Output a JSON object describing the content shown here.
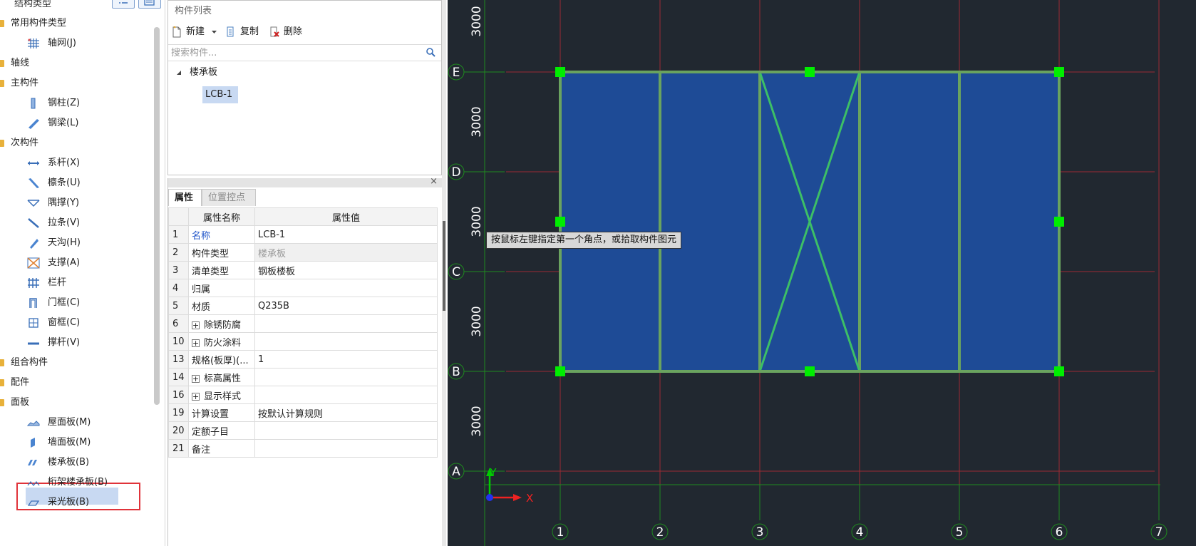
{
  "tree": {
    "header_title": "结构类型",
    "items": [
      {
        "label": "常用构件类型",
        "kind": "group",
        "icon": "folder-icon"
      },
      {
        "label": "轴网(J)",
        "kind": "leaf",
        "icon": "grid-icon"
      },
      {
        "label": "轴线",
        "kind": "group",
        "icon": "folder-icon"
      },
      {
        "label": "主构件",
        "kind": "group",
        "icon": "folder-icon"
      },
      {
        "label": "钢柱(Z)",
        "kind": "leaf",
        "icon": "steel-column-icon"
      },
      {
        "label": "钢梁(L)",
        "kind": "leaf",
        "icon": "steel-beam-icon"
      },
      {
        "label": "次构件",
        "kind": "group",
        "icon": "folder-icon"
      },
      {
        "label": "系杆(X)",
        "kind": "leaf",
        "icon": "tie-rod-icon"
      },
      {
        "label": "檩条(U)",
        "kind": "leaf",
        "icon": "purlin-icon"
      },
      {
        "label": "隅撑(Y)",
        "kind": "leaf",
        "icon": "corner-brace-icon"
      },
      {
        "label": "拉条(V)",
        "kind": "leaf",
        "icon": "sag-rod-icon"
      },
      {
        "label": "天沟(H)",
        "kind": "leaf",
        "icon": "gutter-icon"
      },
      {
        "label": "支撑(A)",
        "kind": "leaf",
        "icon": "brace-icon"
      },
      {
        "label": "栏杆",
        "kind": "leaf",
        "icon": "railing-icon"
      },
      {
        "label": "门框(C)",
        "kind": "leaf",
        "icon": "door-frame-icon"
      },
      {
        "label": "窗框(C)",
        "kind": "leaf",
        "icon": "window-frame-icon"
      },
      {
        "label": "撑杆(V)",
        "kind": "leaf",
        "icon": "strut-icon"
      },
      {
        "label": "组合构件",
        "kind": "group",
        "icon": "folder-icon"
      },
      {
        "label": "配件",
        "kind": "group",
        "icon": "folder-icon"
      },
      {
        "label": "面板",
        "kind": "group",
        "icon": "folder-icon"
      },
      {
        "label": "屋面板(M)",
        "kind": "leaf",
        "icon": "roof-panel-icon"
      },
      {
        "label": "墙面板(M)",
        "kind": "leaf",
        "icon": "wall-panel-icon"
      },
      {
        "label": "楼承板(B)",
        "kind": "leaf",
        "icon": "floor-deck-icon",
        "selected": true
      },
      {
        "label": "桁架楼承板(B)",
        "kind": "leaf",
        "icon": "truss-deck-icon"
      },
      {
        "label": "采光板(B)",
        "kind": "leaf",
        "icon": "skylight-panel-icon"
      }
    ]
  },
  "complist": {
    "title": "构件列表",
    "new_label": "新建",
    "copy_label": "复制",
    "delete_label": "删除",
    "search_placeholder": "搜索构件...",
    "group_label": "楼承板",
    "item_label": "LCB-1"
  },
  "props": {
    "tab_props": "属性",
    "tab_points": "位置控点",
    "col_name": "属性名称",
    "col_value": "属性值",
    "rows": [
      {
        "num": "1",
        "name": "名称",
        "value": "LCB-1",
        "name_style": "blue"
      },
      {
        "num": "2",
        "name": "构件类型",
        "value": "楼承板",
        "value_style": "gray"
      },
      {
        "num": "3",
        "name": "清单类型",
        "value": "钢板楼板"
      },
      {
        "num": "4",
        "name": "归属",
        "value": ""
      },
      {
        "num": "5",
        "name": "材质",
        "value": "Q235B"
      },
      {
        "num": "6",
        "name": "除锈防腐",
        "value": "",
        "expand": true
      },
      {
        "num": "10",
        "name": "防火涂料",
        "value": "",
        "expand": true
      },
      {
        "num": "13",
        "name": "规格(板厚)(...",
        "value": "1"
      },
      {
        "num": "14",
        "name": "标高属性",
        "value": "",
        "expand": true
      },
      {
        "num": "16",
        "name": "显示样式",
        "value": "",
        "expand": true
      },
      {
        "num": "19",
        "name": "计算设置",
        "value": "按默认计算规则"
      },
      {
        "num": "20",
        "name": "定额子目",
        "value": ""
      },
      {
        "num": "21",
        "name": "备注",
        "value": ""
      }
    ]
  },
  "canvas": {
    "tooltip": "按鼠标左键指定第一个角点，或拾取构件图元",
    "row_axes": [
      "A",
      "B",
      "C",
      "D",
      "E"
    ],
    "col_axes": [
      "1",
      "2",
      "3",
      "4",
      "5",
      "6",
      "7"
    ],
    "dims": [
      "3000",
      "3000",
      "3000",
      "3000",
      "3000"
    ],
    "axis_x": "X",
    "axis_y": "Y",
    "colors": {
      "background": "#212830",
      "grid_red": "#9c2a33",
      "grid_green": "#1f8a1f",
      "slab_fill": "#1e4b96",
      "slab_edge": "#6aa35f",
      "brace": "#3dbf66",
      "grip": "#00ee00"
    }
  }
}
